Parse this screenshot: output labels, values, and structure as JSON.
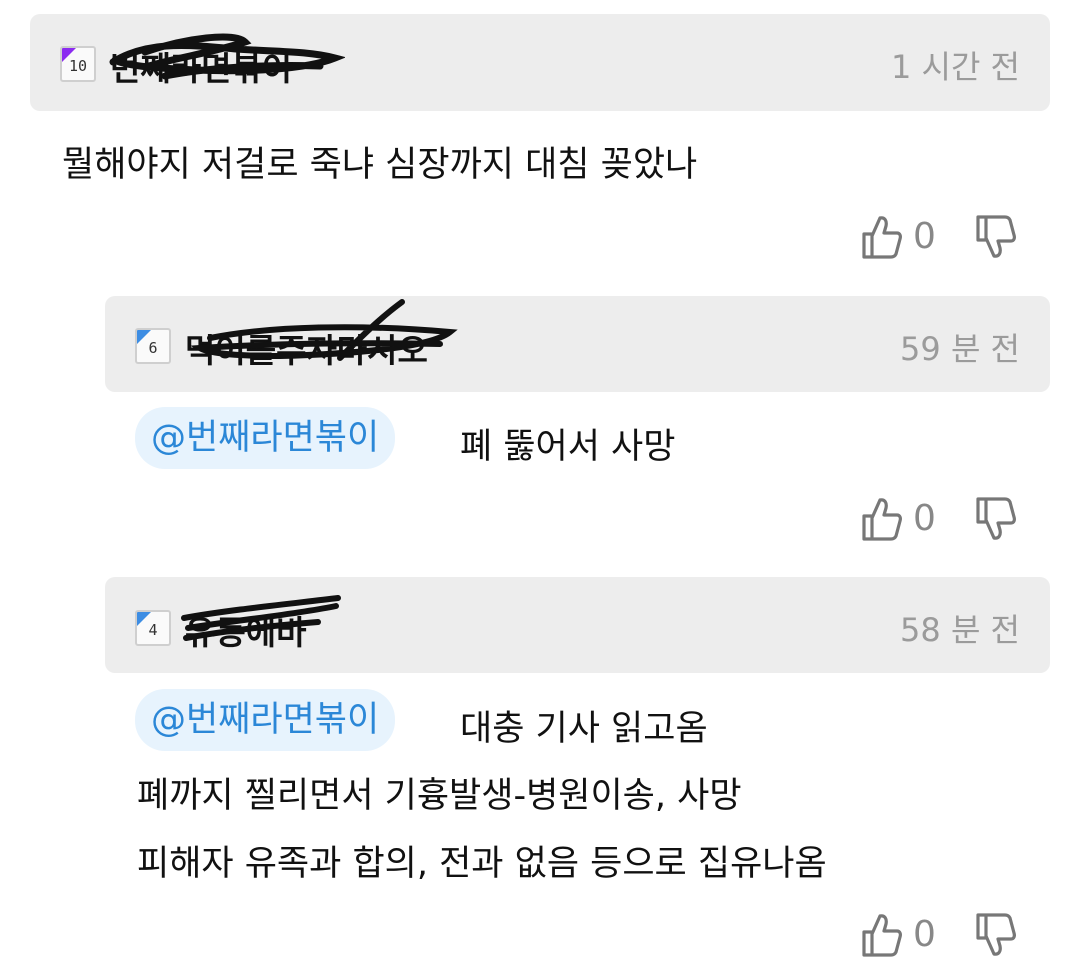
{
  "comments": [
    {
      "level": "10",
      "nickname": "번째라면볶이",
      "time": "1 시간 전",
      "lines": [
        "뭘해야지 저걸로 죽냐 심장까지 대침 꽂았나"
      ],
      "likes": "0"
    },
    {
      "level": "6",
      "nickname": "먹어를주자마시오",
      "time": "59 분 전",
      "mention": "@번째라면볶이",
      "lines": [
        "폐 뚫어서 사망"
      ],
      "likes": "0"
    },
    {
      "level": "4",
      "nickname": "유동에바",
      "time": "58 분 전",
      "mention": "@번째라면볶이",
      "lines": [
        "대충 기사 읽고옴",
        "폐까지 찔리면서 기흉발생-병원이송, 사망",
        "피해자 유족과 합의, 전과 없음 등으로 집유나옴"
      ],
      "likes": "0"
    }
  ],
  "colors": {
    "header_bg": "#ededed",
    "mention_bg": "#e7f3fd",
    "mention_text": "#2b87d7",
    "level10_badge": "#8b2bf0",
    "level_low_badge": "#3d8de3"
  },
  "icons": [
    "thumbs-up-icon",
    "thumbs-down-icon"
  ]
}
